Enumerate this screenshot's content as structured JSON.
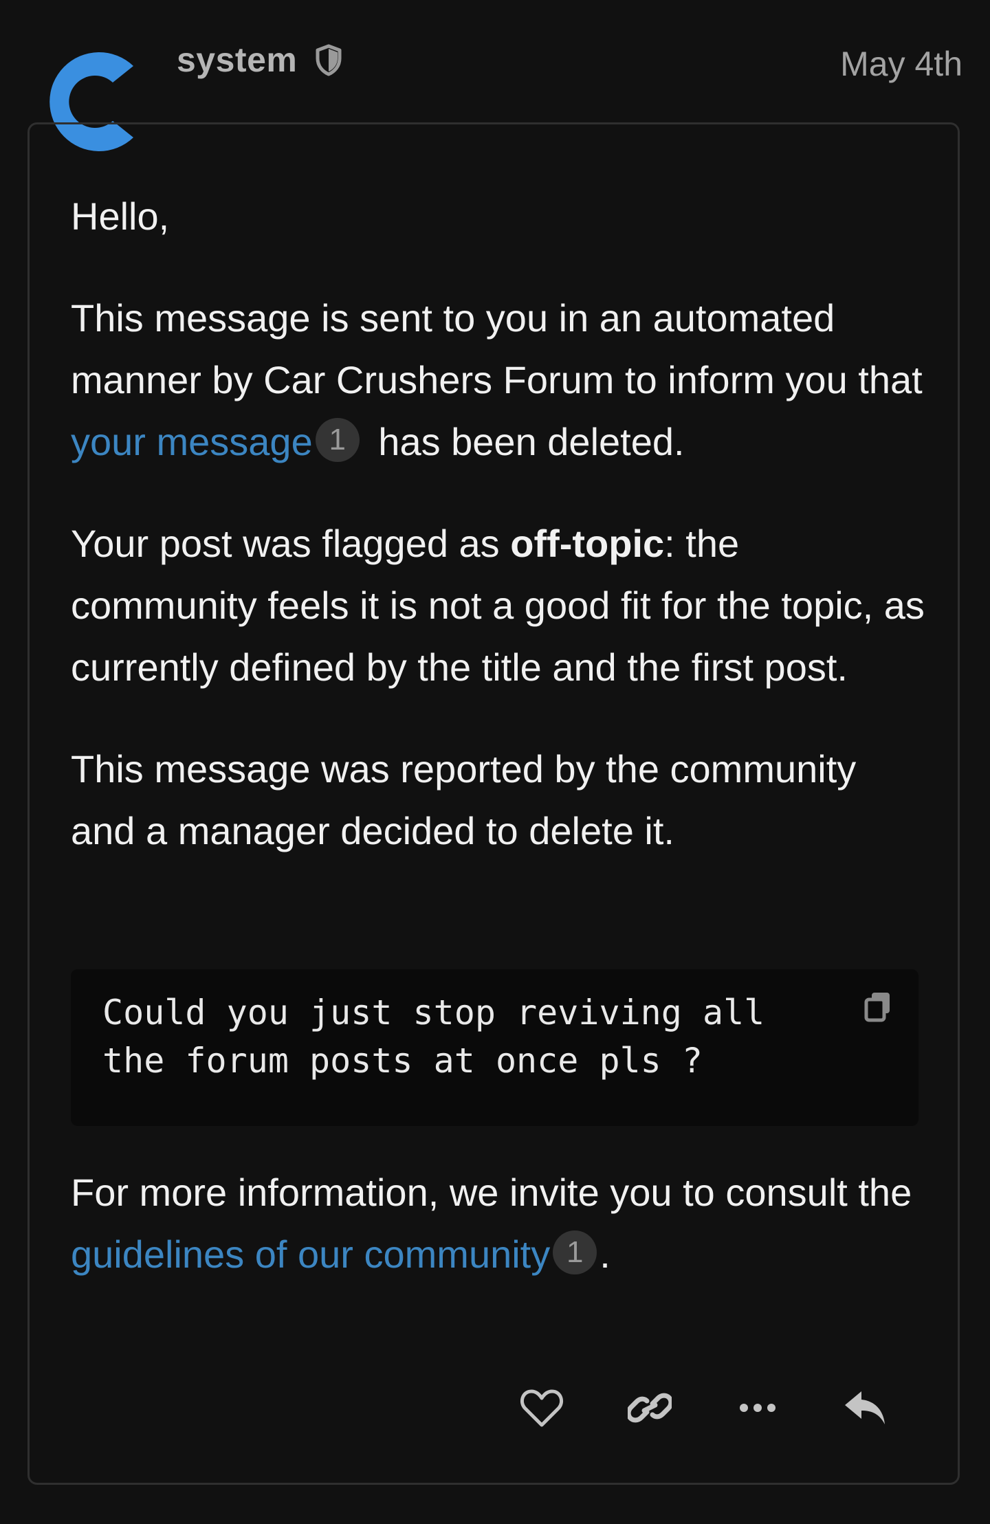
{
  "post": {
    "username": "system",
    "date": "May 4th",
    "greeting": "Hello,",
    "para1_before": "This message is sent to you in an automated manner by Car Crushers Forum to inform you that ",
    "para1_link": "your message",
    "para1_link_count": "1",
    "para1_after": " has been deleted.",
    "para2_before": "Your post was flagged as ",
    "para2_bold": "off-topic",
    "para2_after": ": the community feels it is not a good fit for the topic, as currently defined by the title and the first post.",
    "para3": "This message was reported by the community and a manager decided to delete it.",
    "quote_code": "Could you just stop reviving all the forum posts at once pls ?",
    "para4_before": "For more information, we invite you to consult the ",
    "para4_link": "guidelines of our community",
    "para4_link_count": "1",
    "para4_after": "."
  },
  "icons": {
    "avatar": "letter-c-avatar",
    "shield": "shield-icon",
    "copy": "copy-icon",
    "like": "heart-icon",
    "share": "link-icon",
    "more": "ellipsis-icon",
    "reply": "reply-icon"
  },
  "colors": {
    "background": "#111111",
    "link": "#3c86c2",
    "avatar": "#3a8fe0",
    "muted": "#a3a3a3"
  }
}
